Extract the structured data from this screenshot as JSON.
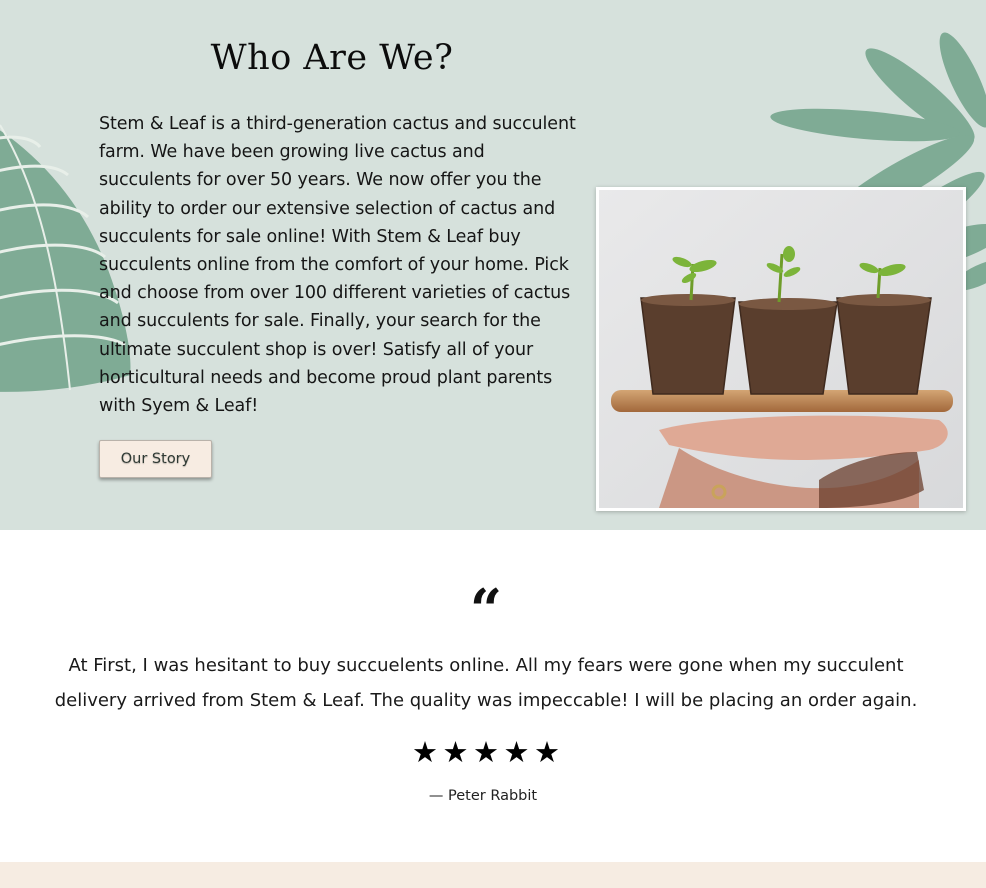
{
  "about": {
    "title": "Who Are We?",
    "body": "Stem & Leaf is a third-generation cactus and succulent farm. We have been growing live cactus and succulents for over 50 years. We now offer you the ability to order our extensive selection of cactus and succulents for sale online! With Stem & Leaf buy succulents online from the comfort of your home. Pick and choose from over 100 different varieties of cactus and succulents for sale. Finally, your search for the ultimate succulent shop is over! Satisfy all of your horticultural needs and become proud plant parents with Syem & Leaf!",
    "button_label": "Our Story",
    "background_color": "#d6e1dc",
    "leaf_color": "#7fab95",
    "button_color": "#f7ece2"
  },
  "photo": {
    "icon": "seedlings-in-peat-pots-photo"
  },
  "testimonial": {
    "quote_mark": "“",
    "text": "At First, I was hesitant to buy succuelents online. All my fears were gone when my succulent delivery arrived from Stem & Leaf. The quality was impeccable! I will be placing an order again.",
    "rating": 5,
    "stars": [
      "★",
      "★",
      "★",
      "★",
      "★"
    ],
    "author": "— Peter Rabbit"
  },
  "footer": {
    "band_color": "#f6ece2"
  }
}
